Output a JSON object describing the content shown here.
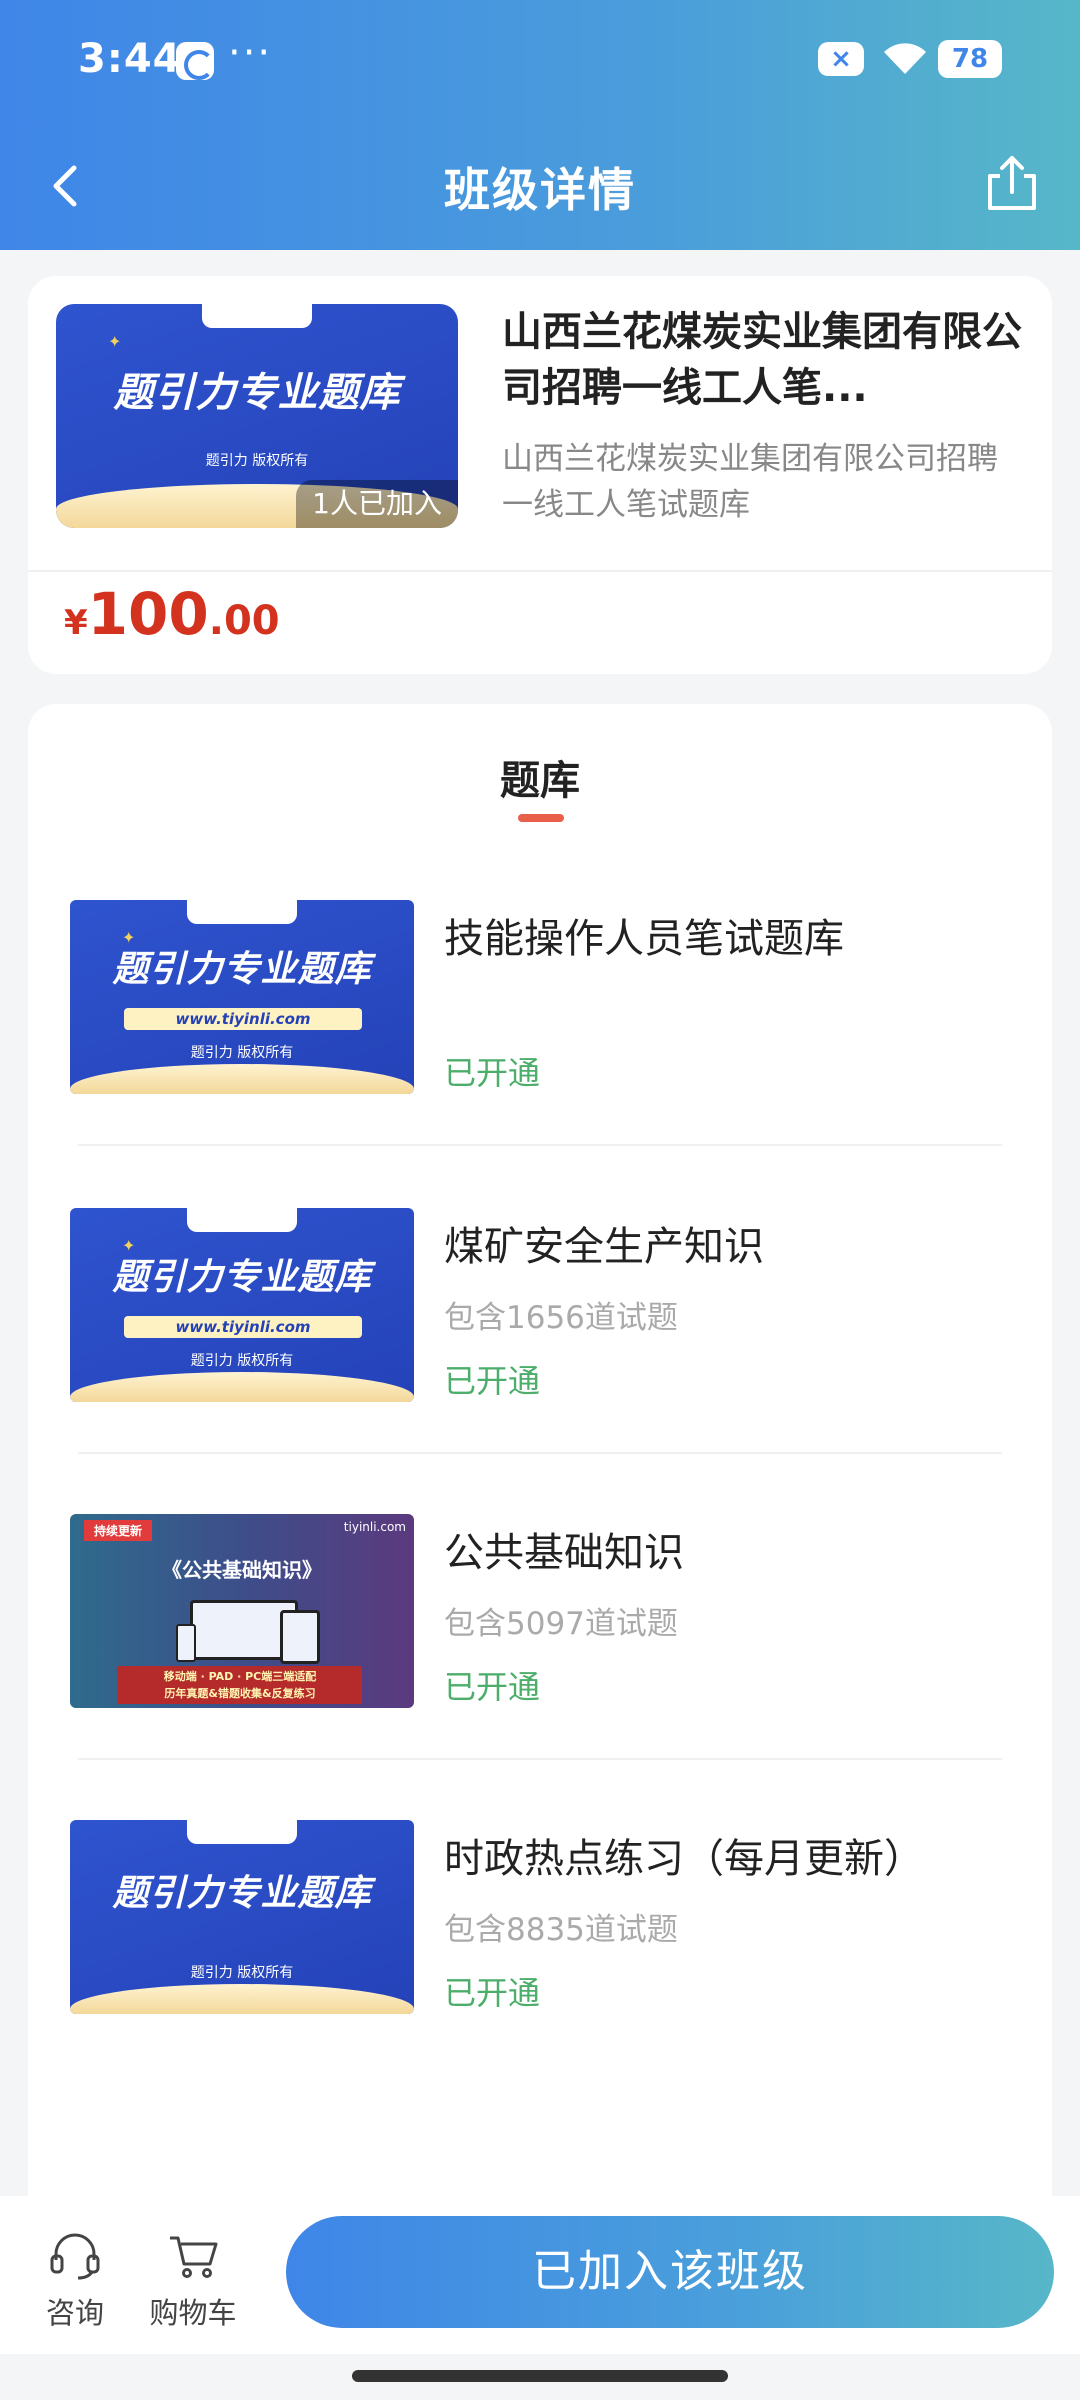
{
  "status_bar": {
    "time": "3:44",
    "dots": "···",
    "battery": "78"
  },
  "nav": {
    "title": "班级详情"
  },
  "class_card": {
    "title": "山西兰花煤炭实业集团有限公司招聘一线工人笔...",
    "subtitle": "山西兰花煤炭实业集团有限公司招聘一线工人笔试题库",
    "joined_badge": "1人已加入",
    "price": {
      "currency": "¥",
      "integer": "100",
      "decimal": ".00"
    }
  },
  "banner": {
    "main_text": "题引力专业题库",
    "url_text": "www.tiyinli.com",
    "copyright": "题引力 版权所有"
  },
  "public_banner": {
    "flag": "持续更新",
    "brand": "tiyinli.com",
    "main_text": "《公共基础知识》",
    "line1": "移动端 · PAD · PC端三端适配",
    "line2": "历年真题&错题收集&反复练习"
  },
  "library": {
    "title": "题库",
    "items": [
      {
        "name": "技能操作人员笔试题库",
        "count": "",
        "status": "已开通"
      },
      {
        "name": "煤矿安全生产知识",
        "count": "包含1656道试题",
        "status": "已开通"
      },
      {
        "name": "公共基础知识",
        "count": "包含5097道试题",
        "status": "已开通"
      },
      {
        "name": "时政热点练习（每月更新）",
        "count": "包含8835道试题",
        "status": "已开通"
      }
    ]
  },
  "bottom_bar": {
    "consult_label": "咨询",
    "cart_label": "购物车",
    "join_label": "已加入该班级"
  },
  "colors": {
    "accent": "#3f86e8",
    "price": "#d3321f",
    "opened": "#4cae6a"
  }
}
